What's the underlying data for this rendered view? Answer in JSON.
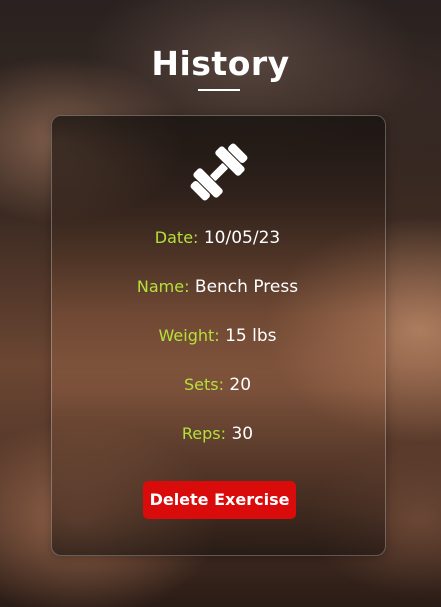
{
  "page": {
    "title": "History"
  },
  "card": {
    "icon": "dumbbell-icon",
    "fields": [
      {
        "label": "Date:",
        "value": "10/05/23"
      },
      {
        "label": "Name:",
        "value": "Bench Press"
      },
      {
        "label": "Weight:",
        "value": "15 lbs"
      },
      {
        "label": "Sets:",
        "value": "20"
      },
      {
        "label": "Reps:",
        "value": "30"
      }
    ],
    "delete_label": "Delete Exercise"
  },
  "colors": {
    "label": "#b6e13a",
    "delete_button": "#d90b0b",
    "text": "#ffffff"
  }
}
